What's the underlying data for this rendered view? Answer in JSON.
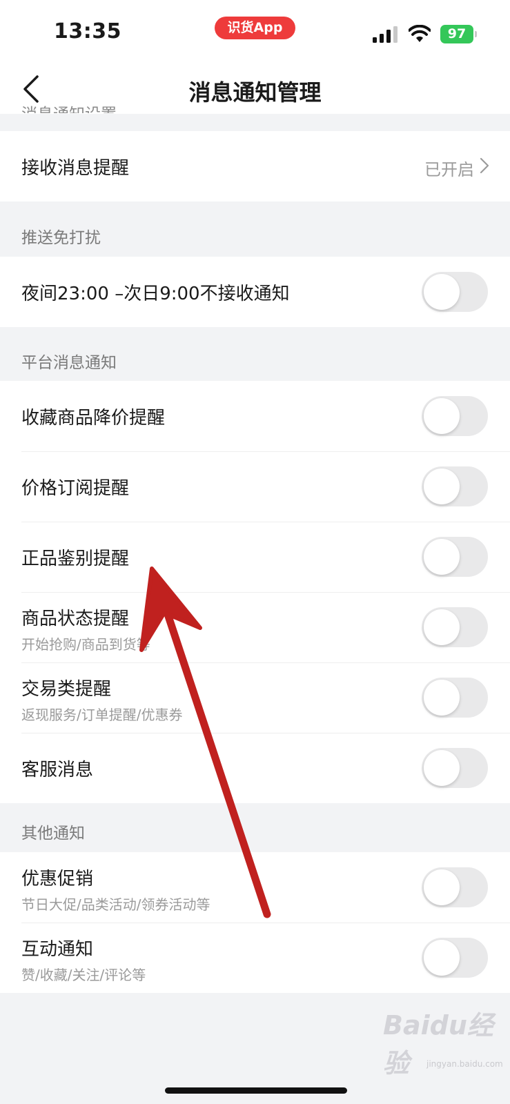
{
  "status_bar": {
    "time": "13:35",
    "app_pill": "识货App",
    "battery": "97"
  },
  "nav": {
    "title": "消息通知管理",
    "cut_section": "消息通知设置"
  },
  "receive_group": {
    "row": {
      "title": "接收消息提醒",
      "value": "已开启"
    }
  },
  "dnd_group": {
    "label": "推送免打扰",
    "rows": [
      {
        "title": "夜间23:00 –次日9:00不接收通知",
        "on": false
      }
    ]
  },
  "platform_group": {
    "label": "平台消息通知",
    "rows": [
      {
        "title": "收藏商品降价提醒",
        "subtitle": "",
        "on": false
      },
      {
        "title": "价格订阅提醒",
        "subtitle": "",
        "on": false
      },
      {
        "title": "正品鉴别提醒",
        "subtitle": "",
        "on": false
      },
      {
        "title": "商品状态提醒",
        "subtitle": "开始抢购/商品到货等",
        "on": false
      },
      {
        "title": "交易类提醒",
        "subtitle": "返现服务/订单提醒/优惠券",
        "on": false
      },
      {
        "title": "客服消息",
        "subtitle": "",
        "on": false
      }
    ]
  },
  "other_group": {
    "label": "其他通知",
    "rows": [
      {
        "title": "优惠促销",
        "subtitle": "节日大促/品类活动/领券活动等",
        "on": false
      },
      {
        "title": "互动通知",
        "subtitle": "赞/收藏/关注/评论等",
        "on": false
      }
    ]
  },
  "watermark": {
    "text": "Baidu经验",
    "sub": "jingyan.baidu.com"
  },
  "colors": {
    "accent_red": "#ee3b3b",
    "battery_green": "#34c759",
    "toggle_off": "#e9e9ea",
    "annotation_arrow": "#c0211f"
  },
  "icons": [
    "signal-icon",
    "wifi-icon",
    "battery-icon",
    "back-icon",
    "chevron-right-icon",
    "annotation-arrow"
  ]
}
